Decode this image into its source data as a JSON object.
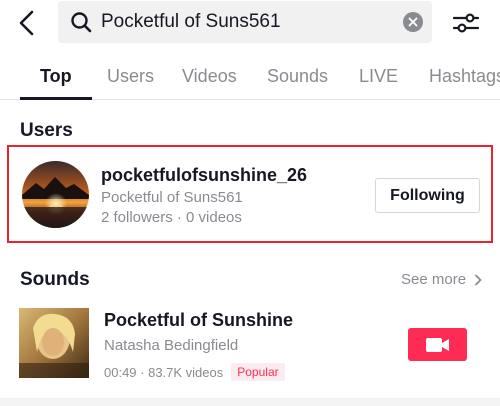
{
  "search": {
    "query": "Pocketful of Suns561"
  },
  "tabs": [
    {
      "label": "Top",
      "active": true
    },
    {
      "label": "Users",
      "active": false
    },
    {
      "label": "Videos",
      "active": false
    },
    {
      "label": "Sounds",
      "active": false
    },
    {
      "label": "LIVE",
      "active": false
    },
    {
      "label": "Hashtags",
      "active": false
    }
  ],
  "users_section": {
    "title": "Users",
    "user": {
      "username": "pocketfulofsunshine_26",
      "display_name": "Pocketful of Suns561",
      "stats": "2 followers · 0 videos",
      "follow_label": "Following"
    }
  },
  "sounds_section": {
    "title": "Sounds",
    "see_more_label": "See more",
    "sound": {
      "title": "Pocketful of Sunshine",
      "artist": "Natasha Bedingfield",
      "stats": "00:49 · 83.7K videos",
      "badge": "Popular"
    }
  },
  "colors": {
    "accent": "#fe2c55",
    "highlight_border": "#e5272d",
    "text_primary": "#161823",
    "text_secondary": "#8a8b91"
  },
  "icons": {
    "back": "chevron-left-icon",
    "search": "search-icon",
    "clear": "clear-icon",
    "filter": "filter-sliders-icon",
    "see_more": "chevron-right-icon",
    "record": "video-camera-icon"
  }
}
